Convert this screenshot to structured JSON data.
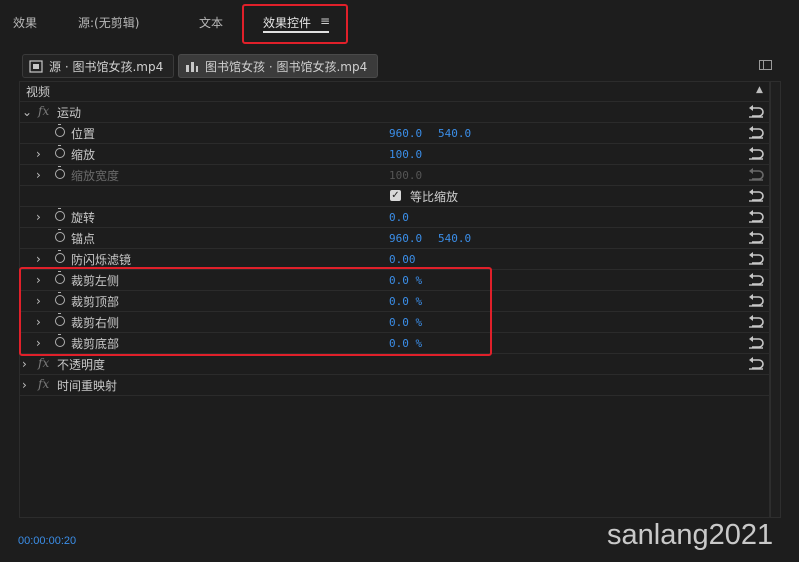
{
  "tabs": {
    "effects": "效果",
    "source": "源:(无剪辑)",
    "text": "文本",
    "effect_controls": "效果控件",
    "menu_glyph": "≡"
  },
  "source_bar": {
    "source_clip": "源 · 图书馆女孩.mp4",
    "sequence_clip": "图书馆女孩 · 图书馆女孩.mp4"
  },
  "section_header": "视频",
  "rows": [
    {
      "type": "group",
      "label": "运动",
      "expanded": true
    },
    {
      "type": "prop",
      "label": "位置",
      "v1": "960.0",
      "v2": "540.0",
      "chev": false
    },
    {
      "type": "prop",
      "label": "缩放",
      "v1": "100.0",
      "chev": true
    },
    {
      "type": "prop",
      "label": "缩放宽度",
      "v1": "100.0",
      "chev": true,
      "disabled": true
    },
    {
      "type": "checkbox",
      "label": "等比缩放",
      "checked": true
    },
    {
      "type": "prop",
      "label": "旋转",
      "v1": "0.0",
      "chev": true
    },
    {
      "type": "prop",
      "label": "锚点",
      "v1": "960.0",
      "v2": "540.0",
      "chev": false
    },
    {
      "type": "prop",
      "label": "防闪烁滤镜",
      "v1": "0.00",
      "chev": true
    },
    {
      "type": "prop",
      "label": "裁剪左侧",
      "v1": "0.0 %",
      "chev": true
    },
    {
      "type": "prop",
      "label": "裁剪顶部",
      "v1": "0.0 %",
      "chev": true
    },
    {
      "type": "prop",
      "label": "裁剪右侧",
      "v1": "0.0 %",
      "chev": true
    },
    {
      "type": "prop",
      "label": "裁剪底部",
      "v1": "0.0 %",
      "chev": true
    },
    {
      "type": "group",
      "label": "不透明度",
      "expanded": false
    },
    {
      "type": "group",
      "label": "时间重映射",
      "expanded": false,
      "noreset": true
    }
  ],
  "timecode": "00:00:00:20",
  "watermark": "sanlang2021",
  "colors": {
    "accent": "#3b8ee8",
    "highlight": "#e0202a",
    "background": "#1d1d1d"
  }
}
